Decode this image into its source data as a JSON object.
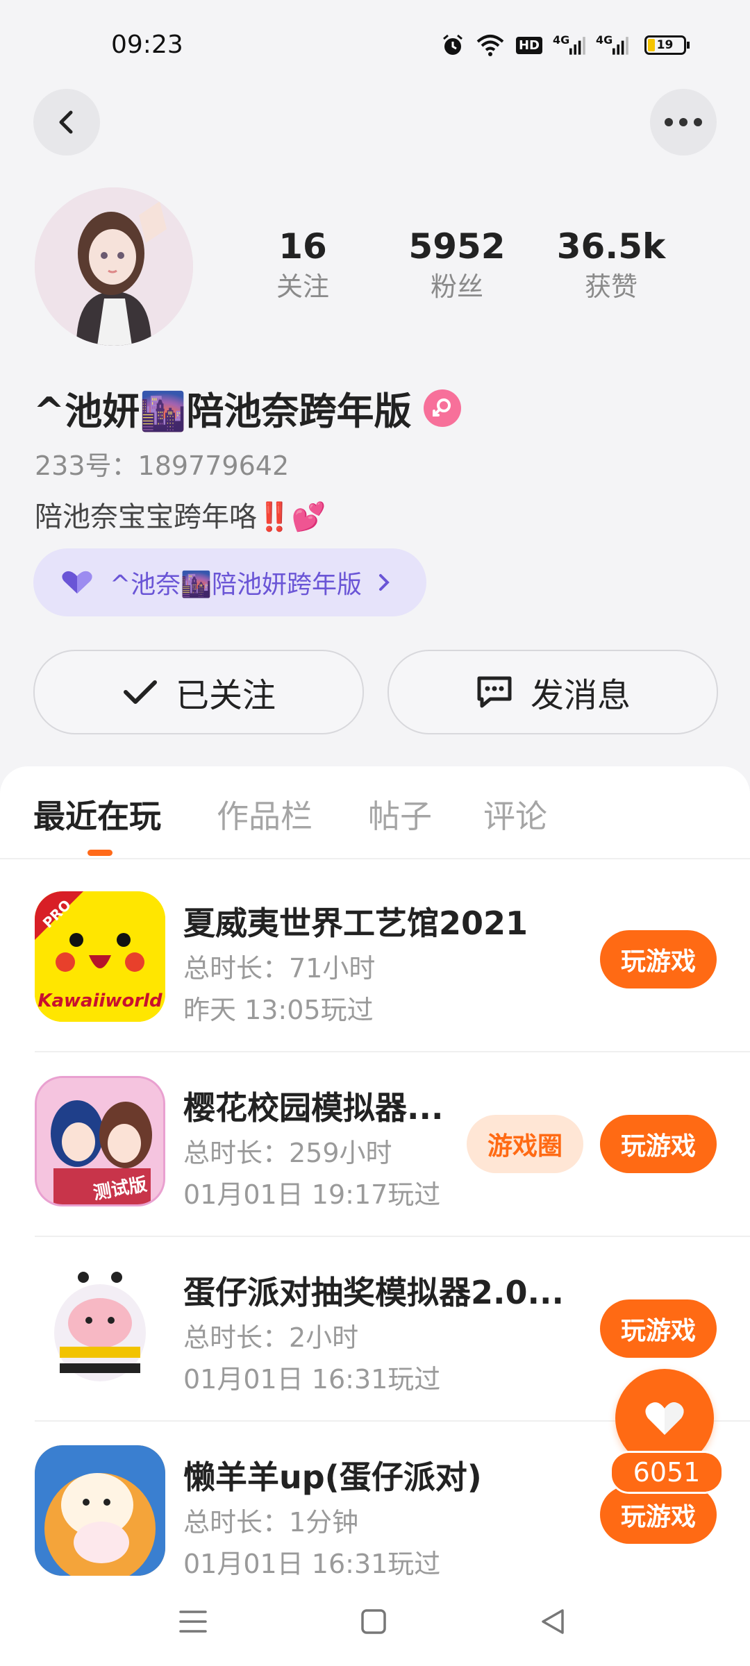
{
  "status_bar": {
    "time": "09:23",
    "icons": [
      "alarm-icon",
      "wifi-icon",
      "hd-icon",
      "signal-4g-icon",
      "signal-4g-icon",
      "battery-icon"
    ],
    "hd": "HD",
    "net1": "4G",
    "net2": "4G",
    "battery": "19"
  },
  "profile": {
    "stats": [
      {
        "value": "16",
        "label": "关注"
      },
      {
        "value": "5952",
        "label": "粉丝"
      },
      {
        "value": "36.5k",
        "label": "获赞"
      }
    ],
    "name": "^池妍🌆陪池奈跨年版",
    "gender_icon": "female-icon",
    "id_text": "233号：189779642",
    "bio": "陪池奈宝宝跨年咯‼️💕",
    "couple_tag": "^池奈🌆陪池妍跨年版"
  },
  "actions": {
    "follow": "已关注",
    "message": "发消息"
  },
  "tabs": [
    {
      "label": "最近在玩",
      "active": true
    },
    {
      "label": "作品栏",
      "active": false
    },
    {
      "label": "帖子",
      "active": false
    },
    {
      "label": "评论",
      "active": false
    }
  ],
  "games": [
    {
      "title": "夏威夷世界工艺馆2021",
      "duration": "总时长：71小时",
      "last_played": "昨天 13:05玩过",
      "icon_badge": "PRO",
      "icon_text": "Kawaiiworld",
      "play_label": "玩游戏"
    },
    {
      "title": "樱花校园模拟器...",
      "duration": "总时长：259小时",
      "last_played": "01月01日 19:17玩过",
      "icon_text": "测试版",
      "circle_label": "游戏圈",
      "play_label": "玩游戏"
    },
    {
      "title": "蛋仔派对抽奖模拟器2.0...",
      "duration": "总时长：2小时",
      "last_played": "01月01日 16:31玩过",
      "play_label": "玩游戏"
    },
    {
      "title": "懒羊羊up(蛋仔派对)",
      "duration": "总时长：1分钟",
      "last_played": "01月01日 16:31玩过",
      "play_label": "玩游戏"
    }
  ],
  "like_fab": {
    "count": "6051"
  },
  "colors": {
    "accent": "#ff6a14",
    "couple_bg": "#e6e3fa",
    "couple_text": "#6a55d6",
    "gender": "#f7709a"
  }
}
